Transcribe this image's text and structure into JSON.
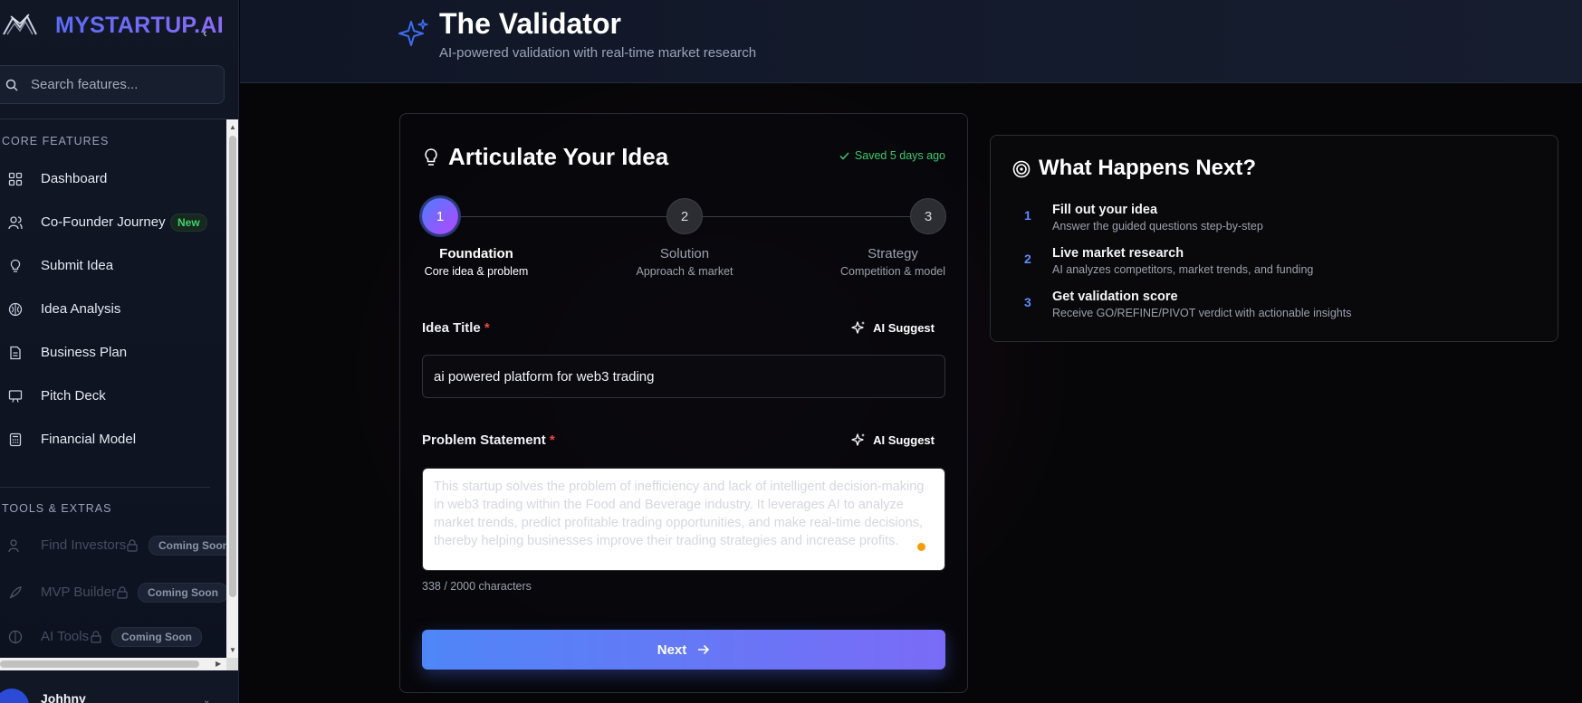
{
  "sidebar": {
    "brand": "MYSTARTUP.AI",
    "collapse_glyph": "‹",
    "search_placeholder": "Search features...",
    "core_title": "CORE FEATURES",
    "core_items": [
      {
        "label": "Dashboard",
        "icon": "grid-icon"
      },
      {
        "label": "Co-Founder Journey",
        "icon": "users-icon",
        "badge": "New"
      },
      {
        "label": "Submit Idea",
        "icon": "lightbulb-icon"
      },
      {
        "label": "Idea Analysis",
        "icon": "brain-icon"
      },
      {
        "label": "Business Plan",
        "icon": "document-icon"
      },
      {
        "label": "Pitch Deck",
        "icon": "presentation-icon"
      },
      {
        "label": "Financial Model",
        "icon": "calculator-icon"
      }
    ],
    "tools_title": "TOOLS & EXTRAS",
    "tool_items": [
      {
        "label": "Find Investors",
        "badge": "Coming Soon"
      },
      {
        "label": "MVP Builder",
        "badge": "Coming Soon"
      },
      {
        "label": "AI Tools",
        "badge": "Coming Soon"
      }
    ],
    "user_name": "Johhny"
  },
  "header": {
    "title": "The Validator",
    "subtitle": "AI-powered validation with real-time market research"
  },
  "form": {
    "title": "Articulate Your Idea",
    "saved": "Saved 5 days ago",
    "steps": [
      {
        "num": "1",
        "name": "Foundation",
        "desc": "Core idea & problem",
        "active": true
      },
      {
        "num": "2",
        "name": "Solution",
        "desc": "Approach & market",
        "active": false
      },
      {
        "num": "3",
        "name": "Strategy",
        "desc": "Competition & model",
        "active": false
      }
    ],
    "idea_title_label": "Idea Title",
    "required_mark": "*",
    "ai_suggest": "AI Suggest",
    "idea_title_value": "ai powered platform for web3 trading",
    "problem_label": "Problem Statement",
    "problem_value": "This startup solves the problem of inefficiency and lack of intelligent decision-making in web3 trading within the Food and Beverage industry. It leverages AI to analyze market trends, predict profitable trading opportunities, and make real-time decisions, thereby helping businesses improve their trading strategies and increase profits.",
    "char_count": "338 / 2000 characters",
    "next_label": "Next"
  },
  "next_panel": {
    "title": "What Happens Next?",
    "items": [
      {
        "num": "1",
        "title": "Fill out your idea",
        "desc": "Answer the guided questions step-by-step"
      },
      {
        "num": "2",
        "title": "Live market research",
        "desc": "AI analyzes competitors, market trends, and funding"
      },
      {
        "num": "3",
        "title": "Get validation score",
        "desc": "Receive GO/REFINE/PIVOT verdict with actionable insights"
      }
    ]
  },
  "colors": {
    "accent": "#5b8cff",
    "brand_gradient_start": "#5a6cf7",
    "brand_gradient_end": "#8b6cf7",
    "saved_green": "#36c96a",
    "required_red": "#ef4444",
    "badge_new_green": "#3fd16b"
  }
}
